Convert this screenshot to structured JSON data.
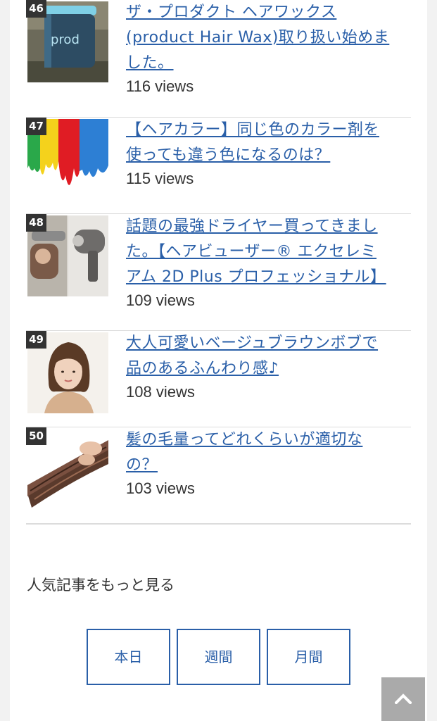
{
  "ranking": [
    {
      "rank": "46",
      "title_lines": [
        "ザ・プロダクト ヘアワックス",
        "(product Hair Wax)取り扱い始めま",
        "した。"
      ],
      "views": "116 views",
      "thumb_text": "prod"
    },
    {
      "rank": "47",
      "title_lines": [
        "【ヘアカラー】同じ色のカラー剤を",
        "使っても違う色になるのは？"
      ],
      "views": "115 views"
    },
    {
      "rank": "48",
      "title_lines": [
        "話題の最強ドライヤー買ってきまし",
        "た。【ヘアビューザー® エクセレミ",
        "アム 2D Plus プロフェッショナル】"
      ],
      "views": "109 views"
    },
    {
      "rank": "49",
      "title_lines": [
        "大人可愛いベージュブラウンボブで",
        "品のあるふんわり感♪"
      ],
      "views": "108 views"
    },
    {
      "rank": "50",
      "title_lines": [
        "髪の毛量ってどれくらいが適切な",
        "の？"
      ],
      "views": "103 views"
    }
  ],
  "more": {
    "label": "人気記事をもっと見る",
    "buttons": [
      "本日",
      "週間",
      "月間"
    ]
  },
  "colors": {
    "link": "#2a5fa8",
    "badge": "#333333",
    "scroll_top": "#aaaaaa"
  },
  "icons": {
    "scroll_top": "chevron-up-icon"
  }
}
